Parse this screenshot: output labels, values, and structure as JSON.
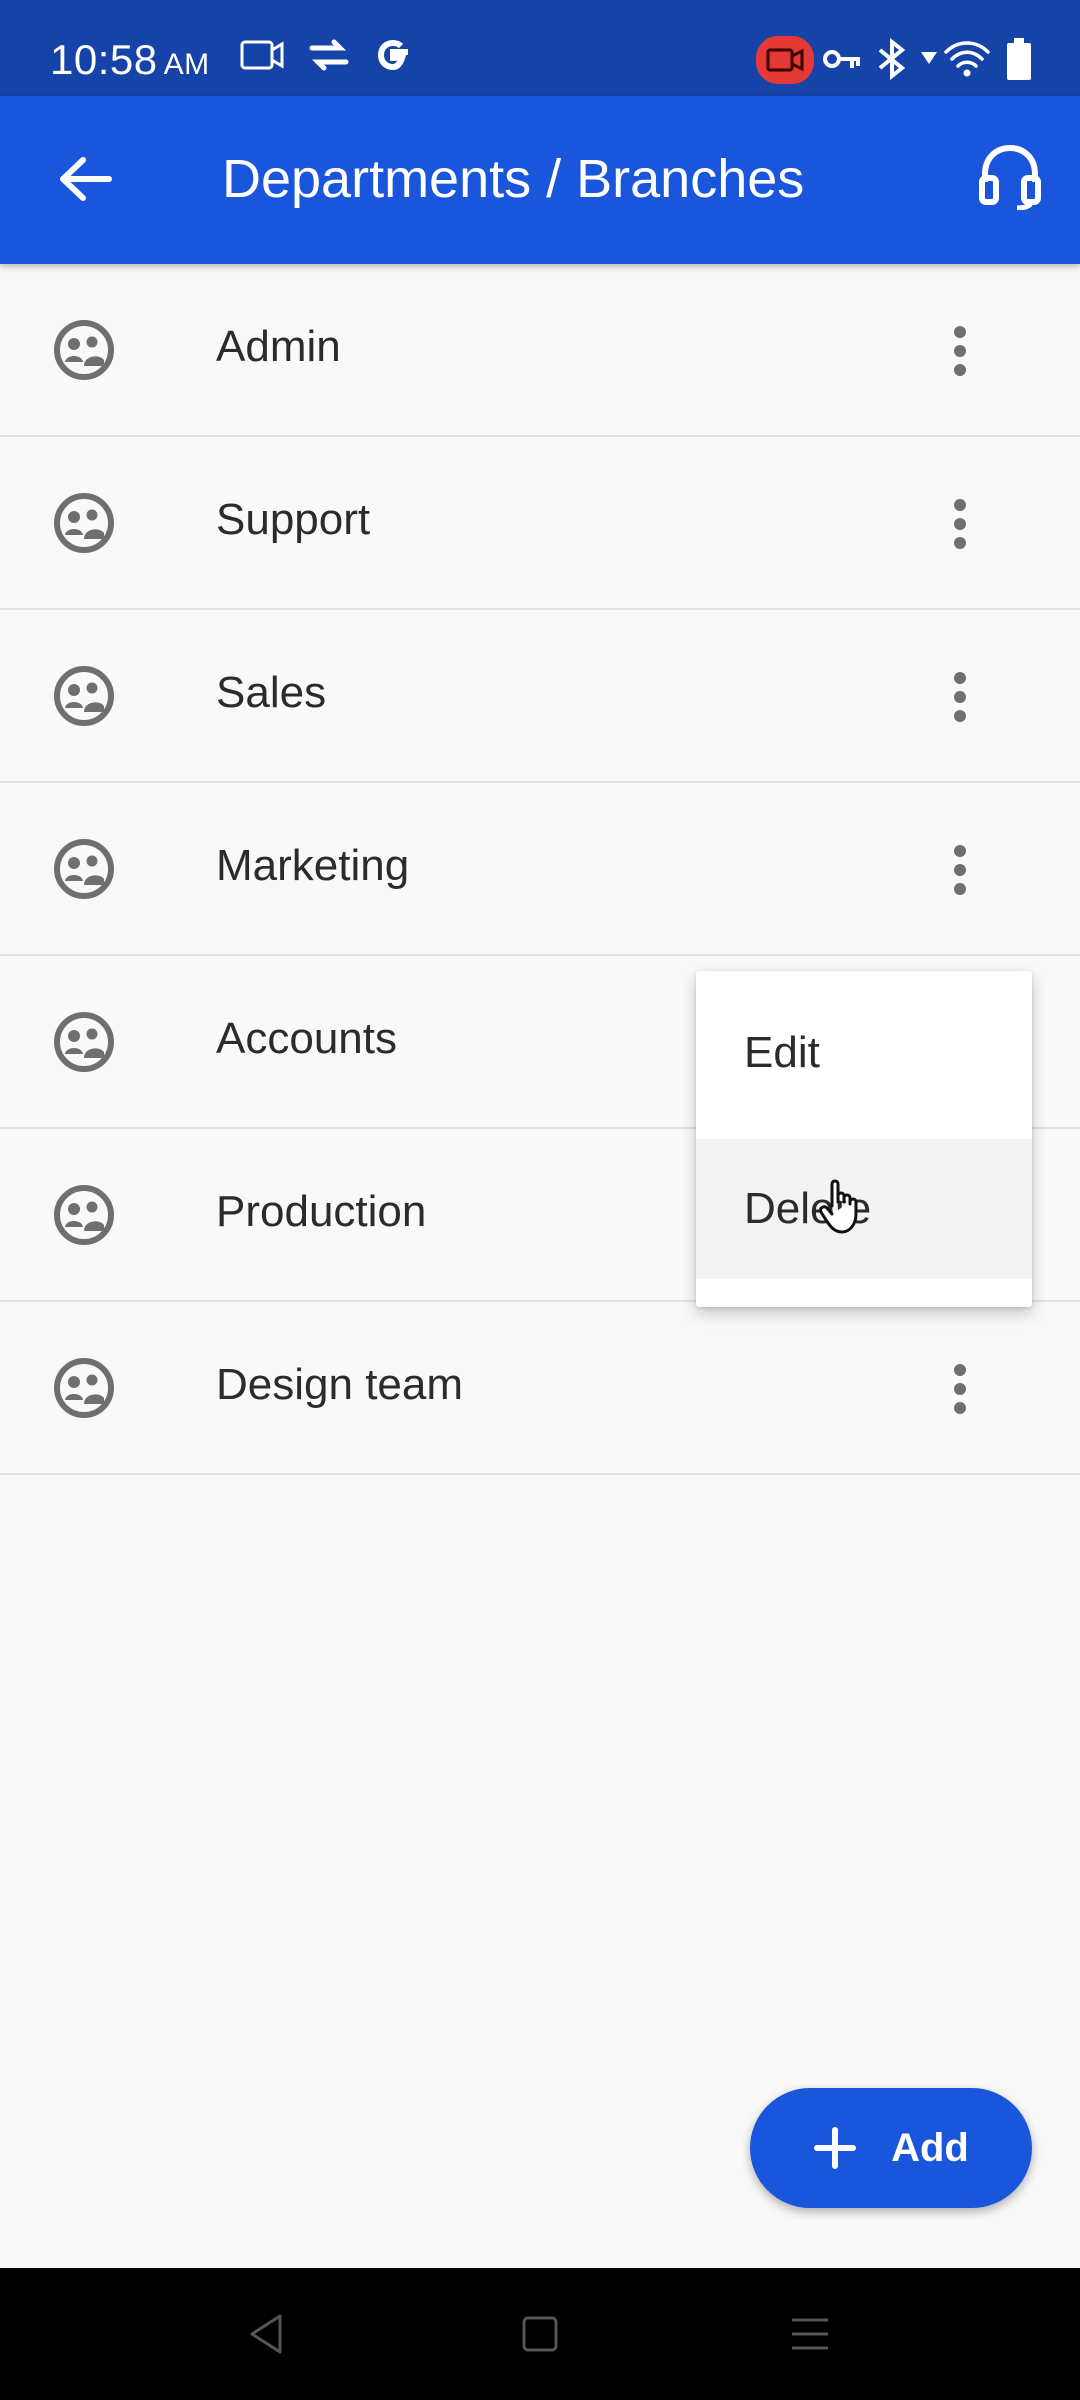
{
  "status_bar": {
    "time": "10:58",
    "ampm": "AM",
    "icons": [
      "screen-record-icon",
      "sync-icon",
      "google-icon",
      "camera-recording-icon",
      "vpn-key-icon",
      "bluetooth-icon",
      "wifi-icon",
      "battery-icon"
    ],
    "record_color": "#e53935"
  },
  "app_bar": {
    "title": "Departments / Branches",
    "background": "#1a56db",
    "back_icon": "arrow-left-icon",
    "support_icon": "headset-icon"
  },
  "departments": [
    {
      "label": "Admin"
    },
    {
      "label": "Support"
    },
    {
      "label": "Sales"
    },
    {
      "label": "Marketing"
    },
    {
      "label": "Accounts"
    },
    {
      "label": "Production"
    },
    {
      "label": "Design team"
    }
  ],
  "context_menu": {
    "items": [
      {
        "label": "Edit"
      },
      {
        "label": "Delete"
      }
    ]
  },
  "fab": {
    "label": "Add",
    "icon": "plus-icon"
  },
  "nav_bar": {
    "icons": [
      "back-triangle-icon",
      "home-square-icon",
      "recents-menu-icon"
    ]
  }
}
